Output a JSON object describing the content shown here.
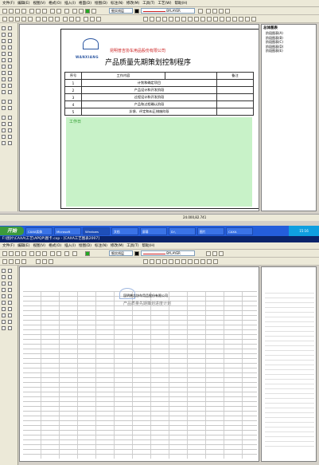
{
  "colors": {
    "accent_red": "#cc2222",
    "green_fill": "#c8f2c8",
    "taskbar": "#245edb",
    "start": "#3c9a3c"
  },
  "window1": {
    "menus": [
      "文件(F)",
      "编辑(E)",
      "视图(V)",
      "格式(O)",
      "插入(I)",
      "格面(D)",
      "绘图(D)",
      "标注(N)",
      "修改(M)",
      "工具(T)",
      "工艺(W)",
      "帮助(H)"
    ],
    "toolbar": {
      "layer_combo": "细实线层",
      "linetype_combo": "BYLAYER"
    },
    "document": {
      "company": "昆明普吉协车用品股份有限公司",
      "logo_label": "WANXIANG",
      "title": "产品质量先期策划控制程序",
      "table_headers": [
        "序号",
        "工作内容",
        "",
        "备注"
      ],
      "rows": [
        {
          "no": "1",
          "content": "计划和确定项目"
        },
        {
          "no": "2",
          "content": "产品设计和开发阶段"
        },
        {
          "no": "3",
          "content": "过程设计和开发阶段"
        },
        {
          "no": "4",
          "content": "产品和过程确认阶段"
        },
        {
          "no": "5",
          "content": "反馈、评定和纠正措施阶段"
        }
      ],
      "green_note": "工作日"
    },
    "panel": {
      "title": "总体图表",
      "items": [
        "阶段图表(A)",
        "阶段图表(B)",
        "阶段图表(C)",
        "阶段图表(D)",
        "阶段图表(E)"
      ]
    },
    "status": {
      "coords": "24.000,82.741"
    }
  },
  "taskbar": {
    "start": "开始",
    "tasks": [
      "CAXA实体",
      "Microsoft",
      "Windows",
      "文档",
      "屏幕",
      "D:\\",
      "图片",
      "CAXA"
    ],
    "clock": "15:16"
  },
  "window2": {
    "title": "F:\\图片\\CAXA\\工艺\\APQP\\图卡.cxp - [CAXA工艺图表2007]",
    "menus": [
      "文件(F)",
      "编辑(E)",
      "视图(V)",
      "格式(O)",
      "插入(I)",
      "绘图(D)",
      "标注(N)",
      "修改(M)",
      "工具(T)",
      "帮助(H)"
    ],
    "toolbar": {
      "layer_combo": "细实线层",
      "linetype_combo": "BYLAYER"
    },
    "document": {
      "header": "昆明普吉协车用品股份有限公司",
      "sub": "产品质量先期策划进度计划"
    }
  }
}
